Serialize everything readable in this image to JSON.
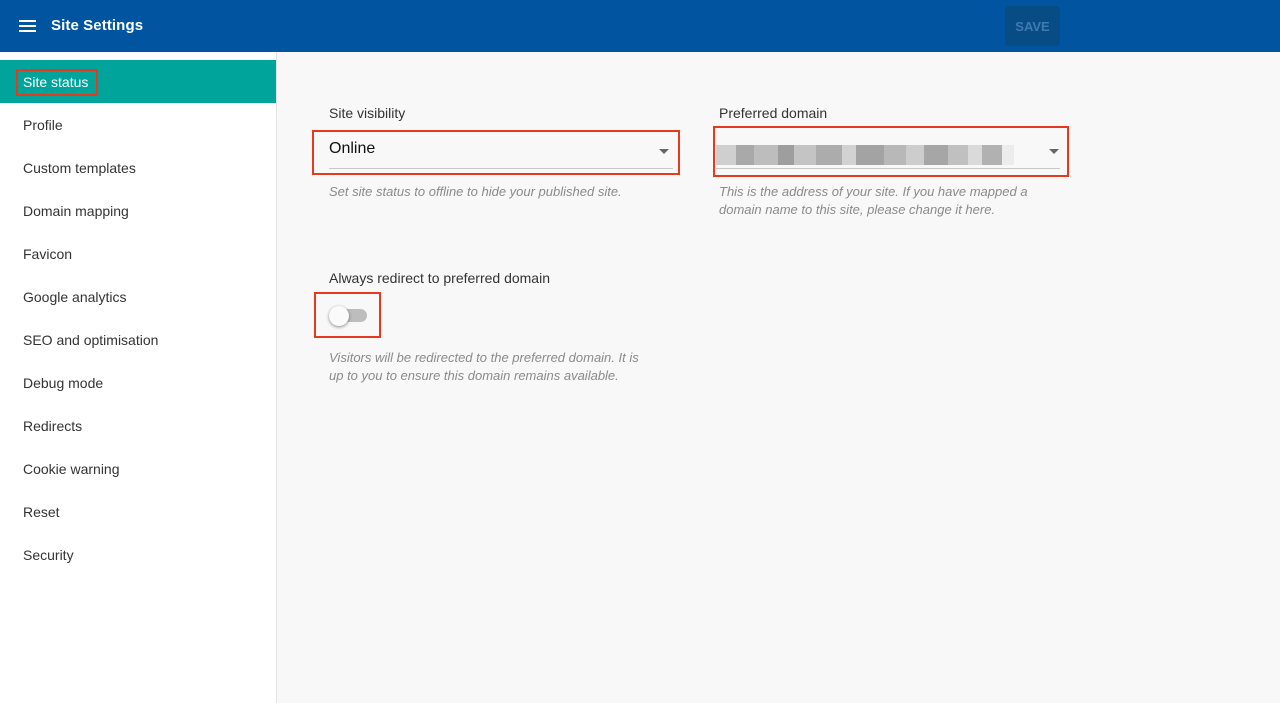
{
  "header": {
    "title": "Site Settings",
    "save_label": "SAVE",
    "menu_icon": "hamburger-menu-icon",
    "background": "#0155a0"
  },
  "sidebar": {
    "active_color": "#00a49a",
    "items": [
      {
        "label": "Site status",
        "active": true
      },
      {
        "label": "Profile"
      },
      {
        "label": "Custom templates"
      },
      {
        "label": "Domain mapping"
      },
      {
        "label": "Favicon"
      },
      {
        "label": "Google analytics"
      },
      {
        "label": "SEO and optimisation"
      },
      {
        "label": "Debug mode"
      },
      {
        "label": "Redirects"
      },
      {
        "label": "Cookie warning"
      },
      {
        "label": "Reset"
      },
      {
        "label": "Security"
      }
    ]
  },
  "site_visibility": {
    "label": "Site visibility",
    "value": "Online",
    "hint": "Set site status to offline to hide your published site."
  },
  "preferred_domain": {
    "label": "Preferred domain",
    "hint_line1": "This is the address of your site. If you have mapped a",
    "hint_line2": "domain name to this site, please change it here."
  },
  "redirect": {
    "label": "Always redirect to preferred domain",
    "toggle_on": false,
    "hint_line1": "Visitors will be redirected to the preferred domain. It is",
    "hint_line2": "up to you to ensure this domain remains available."
  },
  "highlight_color": "#e53a1e"
}
